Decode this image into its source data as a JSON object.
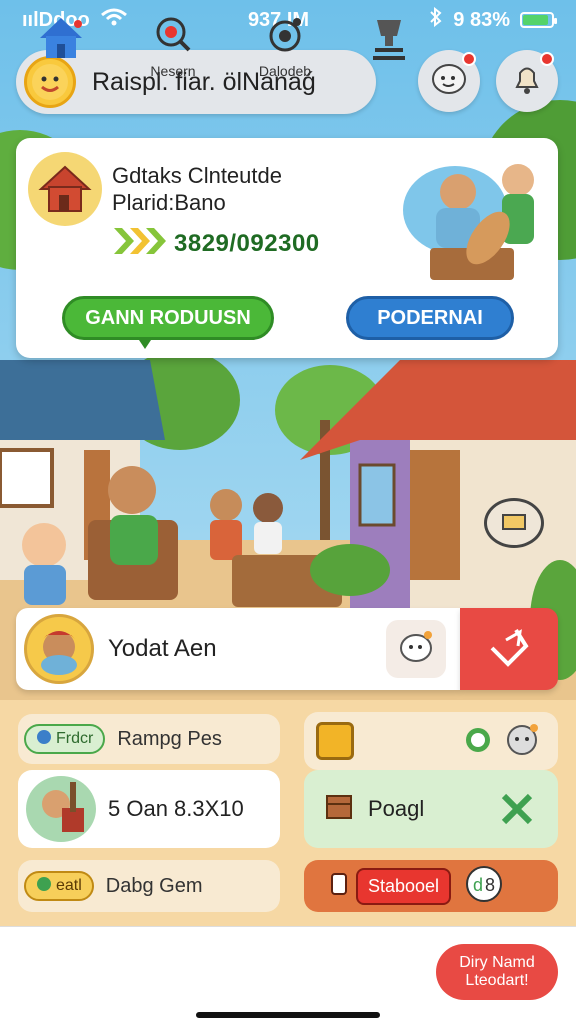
{
  "status_bar": {
    "carrier": "ıılDdoo",
    "time": "937 IM",
    "battery_text": "9 83%",
    "battery_level": 0.83
  },
  "header": {
    "title": "Raispl. fiar. ölNanaǵ"
  },
  "main_card": {
    "title_line1": "Gdtaks Clnteutde",
    "title_line2": "Plarid:Bano",
    "value": "3829/092300",
    "primary_button": "GANN RODUUSN",
    "secondary_button": "PODERNAI"
  },
  "middle_row": {
    "label": "Yodat Aen"
  },
  "panel": {
    "row1_chip": "Frdcr",
    "row1_label": "Rampg Pes",
    "row2_value": "5 Oan 8.3X10",
    "row2_right_label": "Poagl",
    "row3_chip": "eatl",
    "row3_label": "Dabg Gem",
    "row3_button": "Stabooel"
  },
  "tabbar": {
    "tab2_label": "Nesern",
    "tab3_label": "Dalodeb",
    "cta_line1": "Diry Namd",
    "cta_line2": "Lteodart!"
  },
  "colors": {
    "green": "#4bb838",
    "blue": "#2f7fd1",
    "red": "#e84a44",
    "panel": "#f6d8a4"
  }
}
